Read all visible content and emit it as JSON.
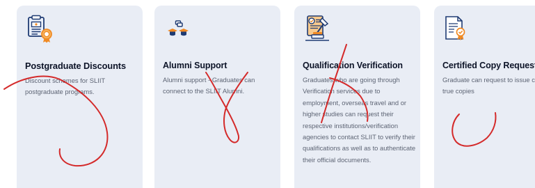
{
  "cards": [
    {
      "icon": "discount-certificate-icon",
      "title": "Postgraduate Discounts",
      "description": "Discount schemes for SLIIT postgraduate programs."
    },
    {
      "icon": "alumni-graduates-icon",
      "title": "Alumni Support",
      "description": "Alumni support - Graduates can connect to the SLIIT Alumni."
    },
    {
      "icon": "verification-stamp-icon",
      "title": "Qualification Verification",
      "description": "Graduates who are going through Verification services due to employment, overseas travel and or higher studies can request their respective institutions/verification agencies to contact SLIIT to verify their qualifications as well as to authenticate their official documents."
    },
    {
      "icon": "certified-copy-icon",
      "title": "Certified Copy Requests",
      "description": "Graduate can request to issue certified true copies"
    }
  ],
  "colors": {
    "card_background": "#e9edf5",
    "title_text": "#0d1428",
    "body_text": "#5d6474",
    "icon_blue": "#1f3b73",
    "icon_orange": "#f08a24",
    "annotation_red": "#d42a2a"
  }
}
